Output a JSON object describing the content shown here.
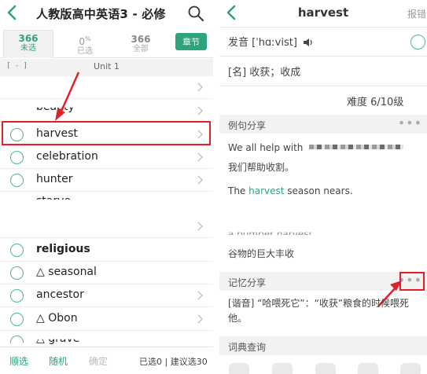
{
  "left": {
    "title": "人教版高中英语3 - 必修",
    "stats": [
      {
        "num": "366",
        "label": "未选"
      },
      {
        "num": "0",
        "sup": "%",
        "label": "已选"
      },
      {
        "num": "366",
        "label": "全部"
      }
    ],
    "chapter_button": "章节",
    "unit_collapse": "[ - ]",
    "unit": "Unit 1",
    "words": [
      {
        "text": "beauty"
      },
      {
        "text": "harvest"
      },
      {
        "text": "celebration"
      },
      {
        "text": "hunter"
      },
      {
        "text": "starve"
      },
      {
        "text": "religious"
      },
      {
        "text": "△ seasonal"
      },
      {
        "text": "ancestor"
      },
      {
        "text": "△ Obon"
      },
      {
        "text": "△ grave"
      }
    ],
    "footer": {
      "invert": "顺选",
      "random": "随机",
      "confirm": "确定",
      "status": "已选0 | 建议选30"
    }
  },
  "right": {
    "title": "harvest",
    "report": "报错",
    "pronunciation_label": "发音 [ˈhɑːvist]",
    "meaning": "[名] 收获；收成",
    "difficulty": "难度 6/10级",
    "sections": {
      "examples": "例句分享",
      "memory": "记忆分享",
      "dictionary": "词典查询"
    },
    "dots": "•••",
    "example1_en": "We all help with",
    "example1_zh": "我们帮助收割。",
    "example2_pre": "The ",
    "example2_word": "harvest",
    "example2_post": " season nears.",
    "example3_fragment": "a bumper harvest",
    "example3_zh": "谷物的巨大丰收",
    "memory_text": "[谐音] “哈喂死它”：“收获”粮食的时候喂死他。"
  },
  "colors": {
    "accent": "#2fa37d",
    "highlight": "#e0202a"
  }
}
